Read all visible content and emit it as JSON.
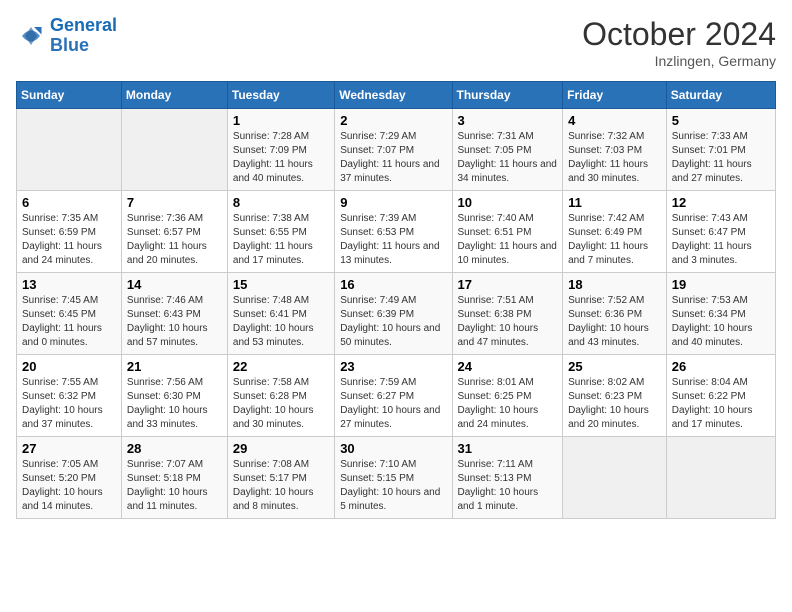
{
  "logo": {
    "general": "General",
    "blue": "Blue"
  },
  "header": {
    "month": "October 2024",
    "location": "Inzlingen, Germany"
  },
  "weekdays": [
    "Sunday",
    "Monday",
    "Tuesday",
    "Wednesday",
    "Thursday",
    "Friday",
    "Saturday"
  ],
  "weeks": [
    [
      {
        "day": "",
        "empty": true
      },
      {
        "day": "",
        "empty": true
      },
      {
        "day": "1",
        "sunrise": "Sunrise: 7:28 AM",
        "sunset": "Sunset: 7:09 PM",
        "daylight": "Daylight: 11 hours and 40 minutes."
      },
      {
        "day": "2",
        "sunrise": "Sunrise: 7:29 AM",
        "sunset": "Sunset: 7:07 PM",
        "daylight": "Daylight: 11 hours and 37 minutes."
      },
      {
        "day": "3",
        "sunrise": "Sunrise: 7:31 AM",
        "sunset": "Sunset: 7:05 PM",
        "daylight": "Daylight: 11 hours and 34 minutes."
      },
      {
        "day": "4",
        "sunrise": "Sunrise: 7:32 AM",
        "sunset": "Sunset: 7:03 PM",
        "daylight": "Daylight: 11 hours and 30 minutes."
      },
      {
        "day": "5",
        "sunrise": "Sunrise: 7:33 AM",
        "sunset": "Sunset: 7:01 PM",
        "daylight": "Daylight: 11 hours and 27 minutes."
      }
    ],
    [
      {
        "day": "6",
        "sunrise": "Sunrise: 7:35 AM",
        "sunset": "Sunset: 6:59 PM",
        "daylight": "Daylight: 11 hours and 24 minutes."
      },
      {
        "day": "7",
        "sunrise": "Sunrise: 7:36 AM",
        "sunset": "Sunset: 6:57 PM",
        "daylight": "Daylight: 11 hours and 20 minutes."
      },
      {
        "day": "8",
        "sunrise": "Sunrise: 7:38 AM",
        "sunset": "Sunset: 6:55 PM",
        "daylight": "Daylight: 11 hours and 17 minutes."
      },
      {
        "day": "9",
        "sunrise": "Sunrise: 7:39 AM",
        "sunset": "Sunset: 6:53 PM",
        "daylight": "Daylight: 11 hours and 13 minutes."
      },
      {
        "day": "10",
        "sunrise": "Sunrise: 7:40 AM",
        "sunset": "Sunset: 6:51 PM",
        "daylight": "Daylight: 11 hours and 10 minutes."
      },
      {
        "day": "11",
        "sunrise": "Sunrise: 7:42 AM",
        "sunset": "Sunset: 6:49 PM",
        "daylight": "Daylight: 11 hours and 7 minutes."
      },
      {
        "day": "12",
        "sunrise": "Sunrise: 7:43 AM",
        "sunset": "Sunset: 6:47 PM",
        "daylight": "Daylight: 11 hours and 3 minutes."
      }
    ],
    [
      {
        "day": "13",
        "sunrise": "Sunrise: 7:45 AM",
        "sunset": "Sunset: 6:45 PM",
        "daylight": "Daylight: 11 hours and 0 minutes."
      },
      {
        "day": "14",
        "sunrise": "Sunrise: 7:46 AM",
        "sunset": "Sunset: 6:43 PM",
        "daylight": "Daylight: 10 hours and 57 minutes."
      },
      {
        "day": "15",
        "sunrise": "Sunrise: 7:48 AM",
        "sunset": "Sunset: 6:41 PM",
        "daylight": "Daylight: 10 hours and 53 minutes."
      },
      {
        "day": "16",
        "sunrise": "Sunrise: 7:49 AM",
        "sunset": "Sunset: 6:39 PM",
        "daylight": "Daylight: 10 hours and 50 minutes."
      },
      {
        "day": "17",
        "sunrise": "Sunrise: 7:51 AM",
        "sunset": "Sunset: 6:38 PM",
        "daylight": "Daylight: 10 hours and 47 minutes."
      },
      {
        "day": "18",
        "sunrise": "Sunrise: 7:52 AM",
        "sunset": "Sunset: 6:36 PM",
        "daylight": "Daylight: 10 hours and 43 minutes."
      },
      {
        "day": "19",
        "sunrise": "Sunrise: 7:53 AM",
        "sunset": "Sunset: 6:34 PM",
        "daylight": "Daylight: 10 hours and 40 minutes."
      }
    ],
    [
      {
        "day": "20",
        "sunrise": "Sunrise: 7:55 AM",
        "sunset": "Sunset: 6:32 PM",
        "daylight": "Daylight: 10 hours and 37 minutes."
      },
      {
        "day": "21",
        "sunrise": "Sunrise: 7:56 AM",
        "sunset": "Sunset: 6:30 PM",
        "daylight": "Daylight: 10 hours and 33 minutes."
      },
      {
        "day": "22",
        "sunrise": "Sunrise: 7:58 AM",
        "sunset": "Sunset: 6:28 PM",
        "daylight": "Daylight: 10 hours and 30 minutes."
      },
      {
        "day": "23",
        "sunrise": "Sunrise: 7:59 AM",
        "sunset": "Sunset: 6:27 PM",
        "daylight": "Daylight: 10 hours and 27 minutes."
      },
      {
        "day": "24",
        "sunrise": "Sunrise: 8:01 AM",
        "sunset": "Sunset: 6:25 PM",
        "daylight": "Daylight: 10 hours and 24 minutes."
      },
      {
        "day": "25",
        "sunrise": "Sunrise: 8:02 AM",
        "sunset": "Sunset: 6:23 PM",
        "daylight": "Daylight: 10 hours and 20 minutes."
      },
      {
        "day": "26",
        "sunrise": "Sunrise: 8:04 AM",
        "sunset": "Sunset: 6:22 PM",
        "daylight": "Daylight: 10 hours and 17 minutes."
      }
    ],
    [
      {
        "day": "27",
        "sunrise": "Sunrise: 7:05 AM",
        "sunset": "Sunset: 5:20 PM",
        "daylight": "Daylight: 10 hours and 14 minutes."
      },
      {
        "day": "28",
        "sunrise": "Sunrise: 7:07 AM",
        "sunset": "Sunset: 5:18 PM",
        "daylight": "Daylight: 10 hours and 11 minutes."
      },
      {
        "day": "29",
        "sunrise": "Sunrise: 7:08 AM",
        "sunset": "Sunset: 5:17 PM",
        "daylight": "Daylight: 10 hours and 8 minutes."
      },
      {
        "day": "30",
        "sunrise": "Sunrise: 7:10 AM",
        "sunset": "Sunset: 5:15 PM",
        "daylight": "Daylight: 10 hours and 5 minutes."
      },
      {
        "day": "31",
        "sunrise": "Sunrise: 7:11 AM",
        "sunset": "Sunset: 5:13 PM",
        "daylight": "Daylight: 10 hours and 1 minute."
      },
      {
        "day": "",
        "empty": true
      },
      {
        "day": "",
        "empty": true
      }
    ]
  ]
}
